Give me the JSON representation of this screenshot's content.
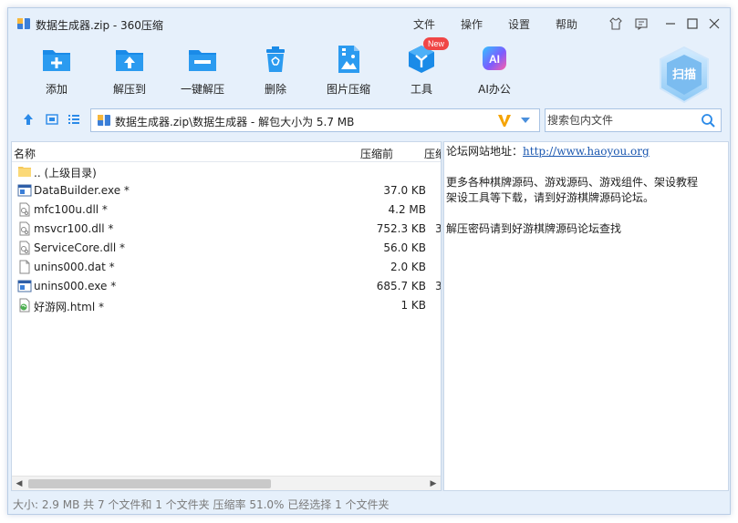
{
  "window": {
    "title": "数据生成器.zip - 360压缩",
    "menus": [
      "文件",
      "操作",
      "设置",
      "帮助"
    ]
  },
  "toolbar": {
    "add": "添加",
    "extract_to": "解压到",
    "one_click": "一键解压",
    "delete": "删除",
    "image_compress": "图片压缩",
    "tools": "工具",
    "new_badge": "New",
    "ai_icon_text": "AI",
    "ai_office": "AI办公",
    "scan": "扫描"
  },
  "address": {
    "path": "数据生成器.zip\\数据生成器 - 解包大小为 5.7 MB"
  },
  "search": {
    "placeholder": "搜索包内文件"
  },
  "columns": {
    "name": "名称",
    "before": "压缩前",
    "after": "压缩"
  },
  "files": [
    {
      "name": ".. (上级目录)",
      "size": "",
      "cut": "",
      "icon": "folder-icon"
    },
    {
      "name": "DataBuilder.exe *",
      "size": "37.0 KB",
      "cut": "",
      "icon": "exe-icon"
    },
    {
      "name": "mfc100u.dll *",
      "size": "4.2 MB",
      "cut": "",
      "icon": "dll-icon"
    },
    {
      "name": "msvcr100.dll *",
      "size": "752.3 KB",
      "cut": "3",
      "icon": "dll-icon"
    },
    {
      "name": "ServiceCore.dll *",
      "size": "56.0 KB",
      "cut": "",
      "icon": "dll-icon"
    },
    {
      "name": "unins000.dat *",
      "size": "2.0 KB",
      "cut": "",
      "icon": "file-icon"
    },
    {
      "name": "unins000.exe *",
      "size": "685.7 KB",
      "cut": "3",
      "icon": "exe-icon"
    },
    {
      "name": "好游网.html *",
      "size": "1 KB",
      "cut": "",
      "icon": "html-icon"
    }
  ],
  "comment": {
    "forum_label": "论坛网站地址：",
    "forum_url": "http://www.haoyou.org",
    "line2a": "更多各种棋牌源码、游戏源码、游戏组件、架设教程",
    "line2b": "架设工具等下载，请到好游棋牌源码论坛。",
    "line3": "解压密码请到好游棋牌源码论坛查找"
  },
  "status": {
    "text": "大小: 2.9 MB 共 7 个文件和 1 个文件夹 压缩率 51.0% 已经选择 1 个文件夹"
  },
  "colors": {
    "accent": "#1a8be8",
    "window_bg": "#e6f0fb"
  }
}
